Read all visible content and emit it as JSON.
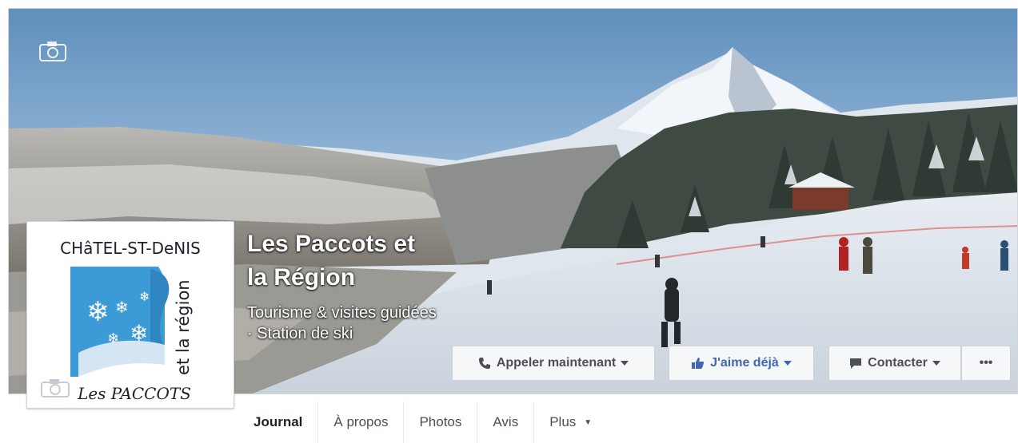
{
  "page": {
    "name": "Les Paccots et la Région",
    "category": "Tourisme & visites guidées · Station de ski"
  },
  "logo": {
    "top_text": "CHâTEL-ST-DeNIS",
    "side_text": "et la région",
    "bottom_text": "Les PACCOTS",
    "brand_color": "#3c9bd6"
  },
  "actions": {
    "call_label": "Appeler maintenant",
    "like_label": "J'aime déjà",
    "contact_label": "Contacter",
    "more_label": "•••"
  },
  "tabs": [
    {
      "label": "Journal"
    },
    {
      "label": "À propos"
    },
    {
      "label": "Photos"
    },
    {
      "label": "Avis"
    },
    {
      "label": "Plus"
    }
  ],
  "icons": {
    "cover_camera": "camera-icon",
    "profile_camera": "camera-icon",
    "call": "phone-icon",
    "like": "thumbs-up-icon",
    "contact": "chat-bubble-icon",
    "more": "ellipsis-icon"
  },
  "colors": {
    "facebook_blue": "#4267b2",
    "button_bg": "#f6f7f9",
    "button_border": "#ced0d4",
    "text_dark": "#1d2129"
  }
}
